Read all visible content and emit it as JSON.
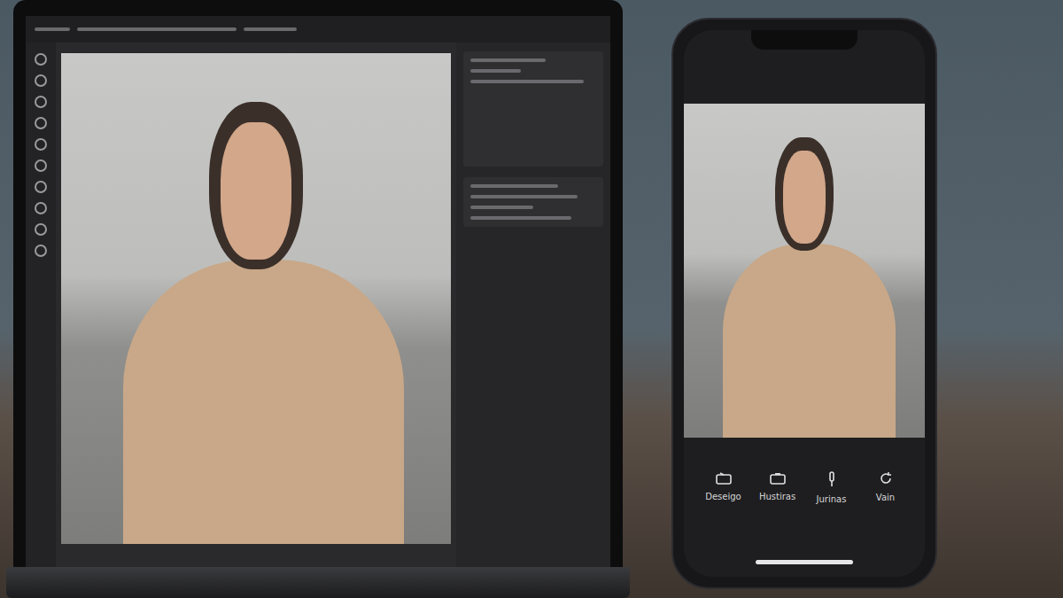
{
  "phone": {
    "tools": [
      {
        "label": "Deseigo"
      },
      {
        "label": "Hustiras"
      },
      {
        "label": "Jurinas"
      },
      {
        "label": "Vain"
      }
    ]
  }
}
